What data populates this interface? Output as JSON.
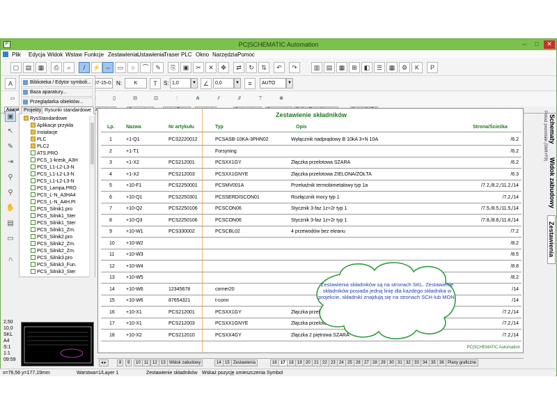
{
  "window": {
    "title": "PC|SCHEMATIC Automation"
  },
  "menu": [
    "Plik",
    "Edycja",
    "Widok",
    "Wstaw",
    "Funkcje",
    "Zestawienia",
    "Ustawienia",
    "Traser",
    "PLC",
    "Okno",
    "Narzędzia",
    "Pomoc"
  ],
  "toolbar2": {
    "path_label": "T:",
    "path_value": "D:\\DPS\\PROGRAMY\\...\\07-15-0:",
    "n_label": "N:",
    "n_value": "K",
    "s_label": "S:",
    "s_value": "1,0",
    "angle_value": "0,0",
    "mode_value": "AUTO"
  },
  "library_tabs": [
    "Aparaty (baza)",
    "Symbole",
    "Rys. standardowe",
    "Pomocnicze",
    "Linie i Teksty",
    "Instalacje",
    "Budownictwo",
    "Pneumatyka",
    "PLC",
    "TechniMechatr",
    "Próbki BAZY"
  ],
  "left_panel": {
    "buttons": [
      "Biblioteka / Edytor symboli...",
      "Baza aparatury...",
      "Przeglądarka obiektów..."
    ],
    "tabs": [
      "Projekty",
      "Rysunki standardowe"
    ],
    "tree": [
      {
        "label": "RysStandardowe",
        "type": "folder",
        "level": 0
      },
      {
        "label": "Aplikacje przykła",
        "type": "folder",
        "level": 1
      },
      {
        "label": "Instalacje",
        "type": "folder",
        "level": 1
      },
      {
        "label": "PLC",
        "type": "folder",
        "level": 1
      },
      {
        "label": "PLC2",
        "type": "folder",
        "level": 1
      },
      {
        "label": "ATS.PRO",
        "type": "file",
        "level": 1
      },
      {
        "label": "PCS_1-kresk_A3H",
        "type": "file",
        "level": 1
      },
      {
        "label": "PCS_L1-L2-L3-N",
        "type": "file",
        "level": 1
      },
      {
        "label": "PCS_L1-L2-L3-N",
        "type": "file",
        "level": 1
      },
      {
        "label": "PCS_L1-L2-L3-N",
        "type": "file",
        "level": 1
      },
      {
        "label": "PCS_Lampa.PRO",
        "type": "file",
        "level": 1
      },
      {
        "label": "PCS_L-N_A3HA4",
        "type": "file",
        "level": 1
      },
      {
        "label": "PCS_L-N_A4H.PI",
        "type": "file",
        "level": 1
      },
      {
        "label": "PCS_Silnik1.pro",
        "type": "file",
        "level": 1
      },
      {
        "label": "PCS_Silnik1_Ster",
        "type": "file",
        "level": 1
      },
      {
        "label": "PCS_Silnik1_Ster",
        "type": "file",
        "level": 1
      },
      {
        "label": "PCS_Silnik1_Zm.",
        "type": "file",
        "level": 1
      },
      {
        "label": "PCS_Silnik2.pro",
        "type": "file",
        "level": 1
      },
      {
        "label": "PCS_Silnik2_Zm.",
        "type": "file",
        "level": 1
      },
      {
        "label": "PCS_Silnik2_Zm.",
        "type": "file",
        "level": 1
      },
      {
        "label": "PCS_Silnik3.pro",
        "type": "file",
        "level": 1
      },
      {
        "label": "PCS_Silnik3_Fun.",
        "type": "file",
        "level": 1
      },
      {
        "label": "PCS_Silnik3_Ster",
        "type": "file",
        "level": 1
      }
    ]
  },
  "status_values": [
    "2,50",
    "10,0",
    "SKL",
    "A4",
    "S:1",
    "1:1",
    "09:59"
  ],
  "sheet": {
    "title": "Zestawienie składników",
    "headers": {
      "lp": "Lp.",
      "nazwa": "Nazwa",
      "artykul": "Nr artykułu",
      "typ": "Typ",
      "opis": "Opis",
      "strona": "Strona/Ścieżka"
    },
    "rows": [
      {
        "lp": "1",
        "nazwa": "+1-Q1",
        "artykul": "PCS2220012",
        "typ": "PCSASB-10KA-3PHN02",
        "opis": "Wyłącznik nadprądowy B 10kA 3+N 10A",
        "strona": "/6.2"
      },
      {
        "lp": "2",
        "nazwa": "+1-T1",
        "artykul": "",
        "typ": "Forsyning",
        "opis": "",
        "strona": "/6.2"
      },
      {
        "lp": "3",
        "nazwa": "+1-X2",
        "artykul": "PCS212001",
        "typ": "PCSXX1GY",
        "opis": "Złączka przelotowa SZARA",
        "strona": "/6.2"
      },
      {
        "lp": "4",
        "nazwa": "+1-X2",
        "artykul": "PCS212003",
        "typ": "PCSXX1GNYE",
        "opis": "Złączka przelotowa ZIELONA/ŻÓŁTA",
        "strona": "/6.3"
      },
      {
        "lp": "5",
        "nazwa": "+10-F1",
        "artykul": "PCS2250001",
        "typ": "PCSMV001A",
        "opis": "Przekaźnik termobimetalowy typ 1a",
        "strona": "/7.2,/8.2,/11.2,/14"
      },
      {
        "lp": "6",
        "nazwa": "+10-Q1",
        "artykul": "PCS2250301",
        "typ": "PCSSERDISCON01",
        "opis": "Rozłącznik mocy typ 1",
        "strona": "/7.2,/14"
      },
      {
        "lp": "7",
        "nazwa": "+10-Q2",
        "artykul": "PCS2250106",
        "typ": "PCSCON06",
        "opis": "Stycznik 3-faz 1z+2r typ 1",
        "strona": "/7.5,/8.5,/11.5,/14"
      },
      {
        "lp": "8",
        "nazwa": "+10-Q3",
        "artykul": "PCS2250106",
        "typ": "PCSCON06",
        "opis": "Stycznik 3-faz 1z+2r typ 1",
        "strona": "/7.8,/8.8,/11.8,/14"
      },
      {
        "lp": "9",
        "nazwa": "+10-W1",
        "artykul": "PCS330002",
        "typ": "PCSCBL02",
        "opis": "4 przewodów bez ekranu",
        "strona": "/7.2"
      },
      {
        "lp": "10",
        "nazwa": "+10-W2",
        "artykul": "",
        "typ": "",
        "opis": "",
        "strona": "/8.2"
      },
      {
        "lp": "11",
        "nazwa": "+10-W3",
        "artykul": "",
        "typ": "",
        "opis": "",
        "strona": "/8.5"
      },
      {
        "lp": "12",
        "nazwa": "+10-W4",
        "artykul": "",
        "typ": "",
        "opis": "",
        "strona": "/8.8"
      },
      {
        "lp": "13",
        "nazwa": "+10-W5",
        "artykul": "",
        "typ": "",
        "opis": "",
        "strona": "/8.2"
      },
      {
        "lp": "14",
        "nazwa": "+10-W6",
        "artykul": "12345678",
        "typ": "corner20",
        "opis": "",
        "strona": "/14"
      },
      {
        "lp": "15",
        "nazwa": "+10-W6",
        "artykul": "87654321",
        "typ": "t-conn",
        "opis": "",
        "strona": "/14"
      },
      {
        "lp": "16",
        "nazwa": "+10-X1",
        "artykul": "PCS212001",
        "typ": "PCSXX1GY",
        "opis": "Złączka przelotowa SZARA",
        "strona": "/7.2,/14"
      },
      {
        "lp": "17",
        "nazwa": "+10-X1",
        "artykul": "PCS212003",
        "typ": "PCSXX1GNYE",
        "opis": "Złączka przelotowa ZIELONA/ŻÓŁTA",
        "strona": "/7.2,/14"
      },
      {
        "lp": "18",
        "nazwa": "+10-X2",
        "artykul": "PCS212010",
        "typ": "PCSXX4GY",
        "opis": "Złączka 2 piętrowa SZARA",
        "strona": "/7.2,/14"
      }
    ],
    "brand": "PC|SCHEMATIC Automation",
    "cloud_text": "Zestawienia składników są na stronach SKL. Zestawienie składników posiada jedną linię dla każdego składnika w projekcie, składniki znajdują się na stronach SCH lub MON."
  },
  "right_tabs": [
    "Schematy",
    "Widok zabudowy",
    "Zestawienia"
  ],
  "right_tab_small": "Pokaż pozostałe (Shift+F9)",
  "page_tabs": [
    "8",
    "9",
    "10",
    "11",
    "12",
    "13",
    "Widok zabudowy",
    "14",
    "15",
    "Zestawienia",
    "16",
    "17",
    "18",
    "19",
    "20",
    "21",
    "22",
    "23",
    "24",
    "25",
    "26",
    "27",
    "28",
    "29",
    "30",
    "31",
    "32",
    "33",
    "34",
    "35",
    "36",
    "Plany graficzne"
  ],
  "active_page": "17",
  "statusbar": {
    "coords": "x=76,56 y=177,19mm",
    "layer": "Warstwa=1/Layer 1",
    "sheet": "Zestawienie składników",
    "hint": "Wskaż pozycję umieszczenia Symbol"
  },
  "colors": {
    "title_green": "#7cc14b",
    "header_green": "#1f7a1f",
    "cloud": "#2e9b3a",
    "cloud_text": "#1f3fb4"
  }
}
